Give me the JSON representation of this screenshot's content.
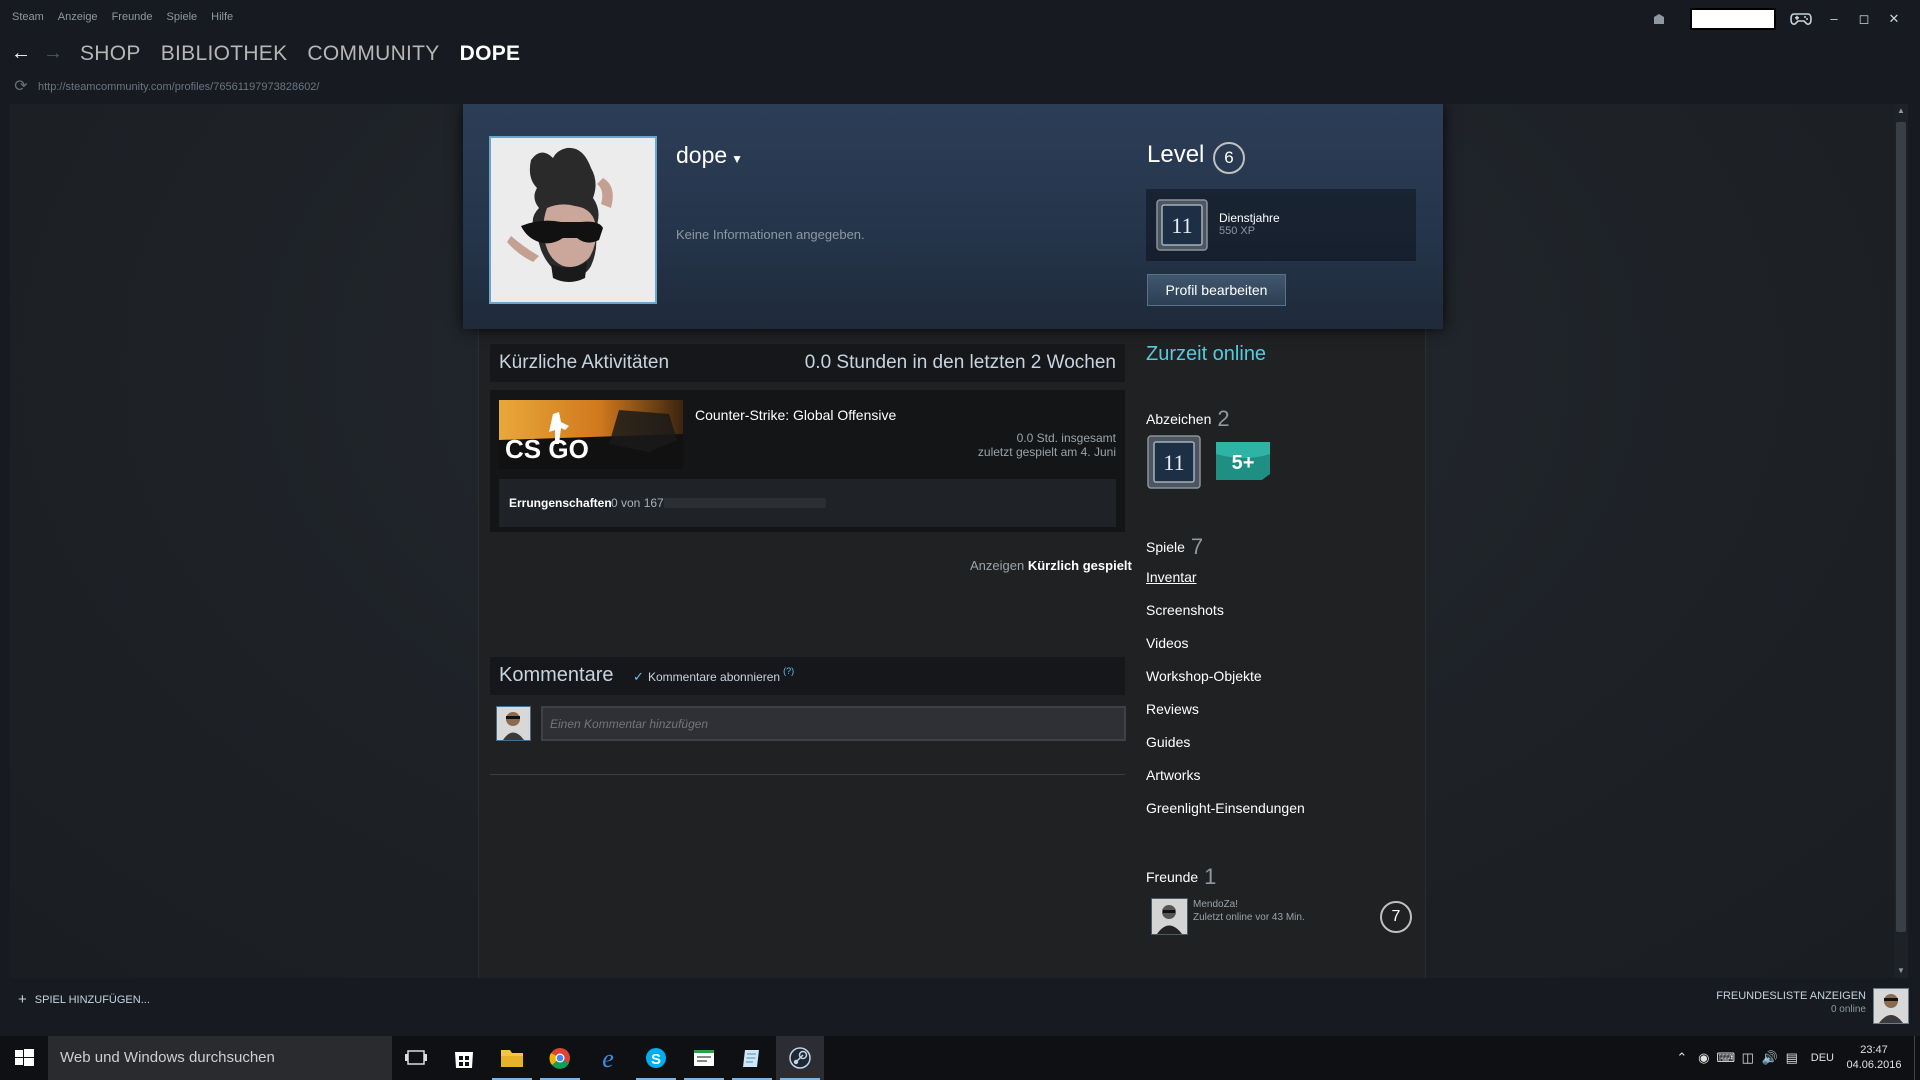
{
  "menu": [
    "Steam",
    "Anzeige",
    "Freunde",
    "Spiele",
    "Hilfe"
  ],
  "nav": {
    "tabs": [
      "SHOP",
      "BIBLIOTHEK",
      "COMMUNITY",
      "DOPE"
    ],
    "active_index": 3
  },
  "url": "http://steamcommunity.com/profiles/76561197973828602/",
  "profile": {
    "name": "dope",
    "summary": "Keine Informationen angegeben.",
    "level_label": "Level",
    "level": "6",
    "badge_title": "Dienstjahre",
    "badge_xp": "550 XP",
    "badge_icon_text": "11",
    "edit_button": "Profil bearbeiten"
  },
  "activity": {
    "title": "Kürzliche Aktivitäten",
    "hours": "0.0 Stunden in den letzten 2 Wochen",
    "game_name": "Counter-Strike: Global Offensive",
    "capsule_text": "CS GO",
    "game_hours": "0.0 Std. insgesamt",
    "game_last_played": "zuletzt gespielt am 4. Juni",
    "achievements_label": "Errungenschaften",
    "achievements_count": "0 von 167",
    "achievements_progress": 0,
    "view_prefix": "Anzeigen",
    "view_link": "Kürzlich gespielt"
  },
  "comments": {
    "title": "Kommentare",
    "subscribe_label": "Kommentare abonnieren",
    "subscribe_checked": true,
    "help": "(?)",
    "placeholder": "Einen Kommentar hinzufügen"
  },
  "sidebar": {
    "status": "Zurzeit online",
    "badges_label": "Abzeichen",
    "badges_count": "2",
    "badge1_text": "11",
    "badge2_text": "5+",
    "games_label": "Spiele",
    "games_count": "7",
    "links": [
      "Inventar",
      "Screenshots",
      "Videos",
      "Workshop-Objekte",
      "Reviews",
      "Guides",
      "Artworks",
      "Greenlight-Einsendungen"
    ],
    "friends_label": "Freunde",
    "friends_count": "1",
    "friend_name": "MendoZa!",
    "friend_status": "Zuletzt online vor 43 Min.",
    "friend_level": "7"
  },
  "bottom": {
    "add_game": "SPIEL HINZUFÜGEN...",
    "friends_list": "FREUNDESLISTE ANZEIGEN",
    "friends_online": "0 online"
  },
  "taskbar": {
    "search_placeholder": "Web und Windows durchsuchen",
    "language": "DEU",
    "time": "23:47",
    "date": "04.06.2016"
  },
  "colors": {
    "accent_online": "#57cbde",
    "link_blue": "#66c0f4",
    "header_blue": "#2c3e57"
  }
}
